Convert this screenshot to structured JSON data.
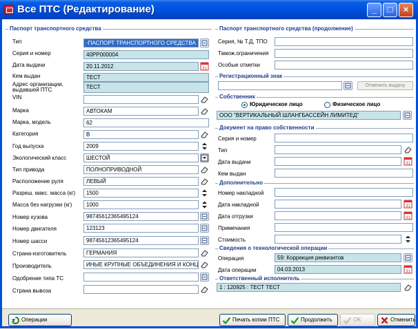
{
  "window": {
    "title": "Все ПТС (Редактирование)"
  },
  "left": {
    "header": "Паспорт транспортного средства",
    "rows": [
      {
        "label": "Тип",
        "value": "-ПАСПОРТ ТРАНСПОРТНОГО СРЕДСТВА"
      },
      {
        "label": "Серия и номер",
        "value": "40PP000004"
      },
      {
        "label": "Дата выдачи",
        "value": "20.11.2012"
      },
      {
        "label": "Кем выдан",
        "value": "ТЕСТ"
      },
      {
        "label": "Адрес организации, выдавшей ПТС",
        "value": "ТЕСТ"
      },
      {
        "label": "VIN",
        "value": ""
      },
      {
        "label": "Марка",
        "value": "АВТОКАМ"
      },
      {
        "label": "Марка, модель",
        "value": "62"
      },
      {
        "label": "Категория",
        "value": "B"
      },
      {
        "label": "Год выпуска",
        "value": "2009"
      },
      {
        "label": "Экологический класс",
        "value": "ШЕСТОЙ"
      },
      {
        "label": "Тип привода",
        "value": "ПОЛНОПРИВОДНОЙ"
      },
      {
        "label": "Расположение руля",
        "value": "ЛЕВЫЙ"
      },
      {
        "label": "Разреш. макс. масса (кг)",
        "value": "1500"
      },
      {
        "label": "Масса без нагрузки (кг)",
        "value": "1000"
      },
      {
        "label": "Номер кузова",
        "value": "98745612365495124"
      },
      {
        "label": "Номер двигателя",
        "value": "123123"
      },
      {
        "label": "Номер шасси",
        "value": "98745612365495124"
      },
      {
        "label": "Страна-изготовитель",
        "value": "ГЕРМАНИЯ"
      },
      {
        "label": "Производитель",
        "value": "ИНЫЕ КРУПНЫЕ ОБЪЕДИНЕНИЯ И КОНЦЕ"
      },
      {
        "label": "Одобрение типа ТС",
        "value": ""
      },
      {
        "label": "Страна вывоза",
        "value": ""
      }
    ]
  },
  "right": {
    "cont": {
      "header": "Паспорт транспортного средства (продолжение)",
      "rows": [
        {
          "label": "Серия, № Т.Д, ТПО",
          "value": ""
        },
        {
          "label": "Тамож.ограничения",
          "value": ""
        },
        {
          "label": "Особые отметки",
          "value": ""
        }
      ]
    },
    "reg": {
      "header": "Регистрационный знак",
      "value": "",
      "cancel_label": "Отменить выдачу"
    },
    "owner": {
      "header": "Собственник",
      "radio_legal": "Юридическое лицо",
      "radio_person": "Физическое лицо",
      "value": "ООО \"ВЕРТИКАЛЬНЫЙ ШЛАНГБАССЕЙН ЛИМИТЕД\""
    },
    "doc": {
      "header": "Документ на право собственности",
      "rows": [
        {
          "label": "Серия и номер",
          "value": ""
        },
        {
          "label": "Тип",
          "value": ""
        },
        {
          "label": "Дата выдачи",
          "value": ""
        },
        {
          "label": "Кем выдан",
          "value": ""
        }
      ]
    },
    "extra": {
      "header": "Дополнительно",
      "rows": [
        {
          "label": "Номер накладной",
          "value": ""
        },
        {
          "label": "Дата накладной",
          "value": ""
        },
        {
          "label": "Дата отгрузки",
          "value": ""
        },
        {
          "label": "Примечания",
          "value": ""
        },
        {
          "label": "Стоимость",
          "value": ""
        }
      ]
    },
    "tech": {
      "header": "Сведения о технологической операции",
      "rows": [
        {
          "label": "Операция",
          "value": "59: Коррекция реквизитов"
        },
        {
          "label": "Дата операции",
          "value": "04.03.2013"
        }
      ]
    },
    "resp": {
      "header": "Ответственный исполнитель",
      "value": "1 : 120925 : ТЕСТ ТЕСТ"
    }
  },
  "buttons": {
    "operations": "Операции",
    "print_copy": "Печать копии ПТС",
    "continue": "Продолжить",
    "ok": "OK",
    "cancel": "Отменить"
  },
  "colors": {
    "title_bar": "#0055e5",
    "readonly_field": "#c7e4e9",
    "selected_field": "#316ac5",
    "group_header": "#1c3c8c"
  }
}
